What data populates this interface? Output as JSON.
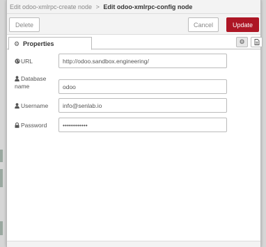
{
  "breadcrumb": {
    "prev": "Edit odoo-xmlrpc-create node",
    "separator": ">",
    "current": "Edit odoo-xmlrpc-config node"
  },
  "toolbar": {
    "delete_label": "Delete",
    "cancel_label": "Cancel",
    "update_label": "Update",
    "accent_color": "#ad1625"
  },
  "tabs": {
    "properties_label": "Properties",
    "properties_icon": "cog-icon",
    "settings_icon": "gear-icon",
    "description_icon": "file-icon"
  },
  "form": {
    "url": {
      "label": "URL",
      "icon": "globe-icon",
      "value": "http://odoo.sandbox.engineering/"
    },
    "database": {
      "label_line1": "Database",
      "label_line2": "name",
      "icon": "user-icon",
      "value": "odoo"
    },
    "username": {
      "label": "Username",
      "icon": "user-icon",
      "value": "info@senlab.io"
    },
    "password": {
      "label": "Password",
      "icon": "lock-icon",
      "value": "••••••••••••"
    }
  }
}
